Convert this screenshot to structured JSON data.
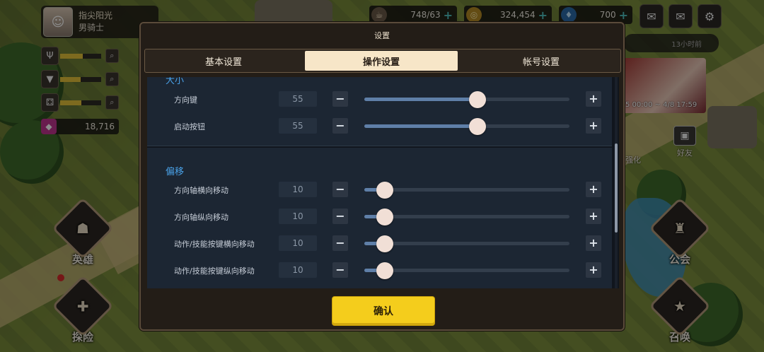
{
  "background": {
    "player": {
      "name": "指尖阳光",
      "class": "男骑士"
    },
    "resources": {
      "gem_count": "18,716",
      "stat_fill": [
        0.55,
        0.5,
        0.52
      ]
    },
    "currencies": [
      {
        "icon": "coffee-cup-icon",
        "value": "748/63"
      },
      {
        "icon": "gold-coin-icon",
        "value": "324,454"
      },
      {
        "icon": "diamond-icon",
        "value": "700"
      }
    ],
    "menu": {
      "hero": "英雄",
      "explore": "探险",
      "guild": "公会",
      "summon": "召唤",
      "enhance": "强化",
      "friends": "好友"
    },
    "notice_time": "13小时前",
    "event_dates": "5 00:00 ~ 4/8 17:59"
  },
  "dialog": {
    "title": "设置",
    "tabs": [
      {
        "label": "基本设置",
        "active": false
      },
      {
        "label": "操作设置",
        "active": true
      },
      {
        "label": "帐号设置",
        "active": false
      }
    ],
    "sections": [
      {
        "title": "大小",
        "rows": [
          {
            "label": "方向键",
            "value": "55",
            "fraction": 0.55
          },
          {
            "label": "启动按钮",
            "value": "55",
            "fraction": 0.55
          }
        ]
      },
      {
        "title": "偏移",
        "rows": [
          {
            "label": "方向轴横向移动",
            "value": "10",
            "fraction": 0.1
          },
          {
            "label": "方向轴纵向移动",
            "value": "10",
            "fraction": 0.1
          },
          {
            "label": "动作/技能按键横向移动",
            "value": "10",
            "fraction": 0.1
          },
          {
            "label": "动作/技能按键纵向移动",
            "value": "10",
            "fraction": 0.1
          }
        ]
      }
    ],
    "confirm_label": "确认",
    "accent_color": "#f4cd1c",
    "section_title_color": "#4aa2e8"
  }
}
